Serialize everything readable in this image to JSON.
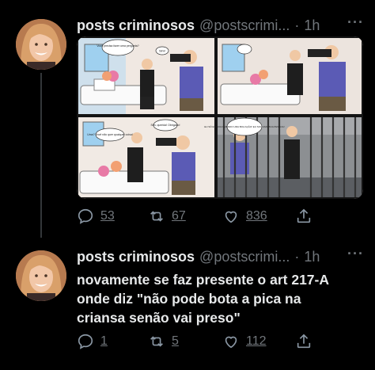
{
  "tweets": [
    {
      "author_name": "posts criminosos",
      "author_handle": "@postscrimi...",
      "separator": "·",
      "time": "1h",
      "more_label": "···",
      "media": {
        "panel1_bubble1": "Você precisa fazer uma pergunta?",
        "panel1_bubble2": "Sim!",
        "panel3_bubble1": "Uma? Você não quer qualquer coisa!",
        "panel3_bubble2": "Sim, querida! Obrigado!",
        "panel4_bubble": "EU SÓ ESTAVA FAZENDO UMA BOA AÇÃO! EU SOU UMA BOA PESSOA!"
      },
      "actions": {
        "replies": "53",
        "retweets": "67",
        "likes": "836"
      }
    },
    {
      "author_name": "posts criminosos",
      "author_handle": "@postscrimi...",
      "separator": "·",
      "time": "1h",
      "more_label": "···",
      "text_lines": [
        "novamente se faz presente o art 217-A",
        "onde diz \"não pode bota a pica na",
        "criansa senão vai preso\""
      ],
      "actions": {
        "replies": "1",
        "retweets": "5",
        "likes": "112"
      }
    }
  ]
}
